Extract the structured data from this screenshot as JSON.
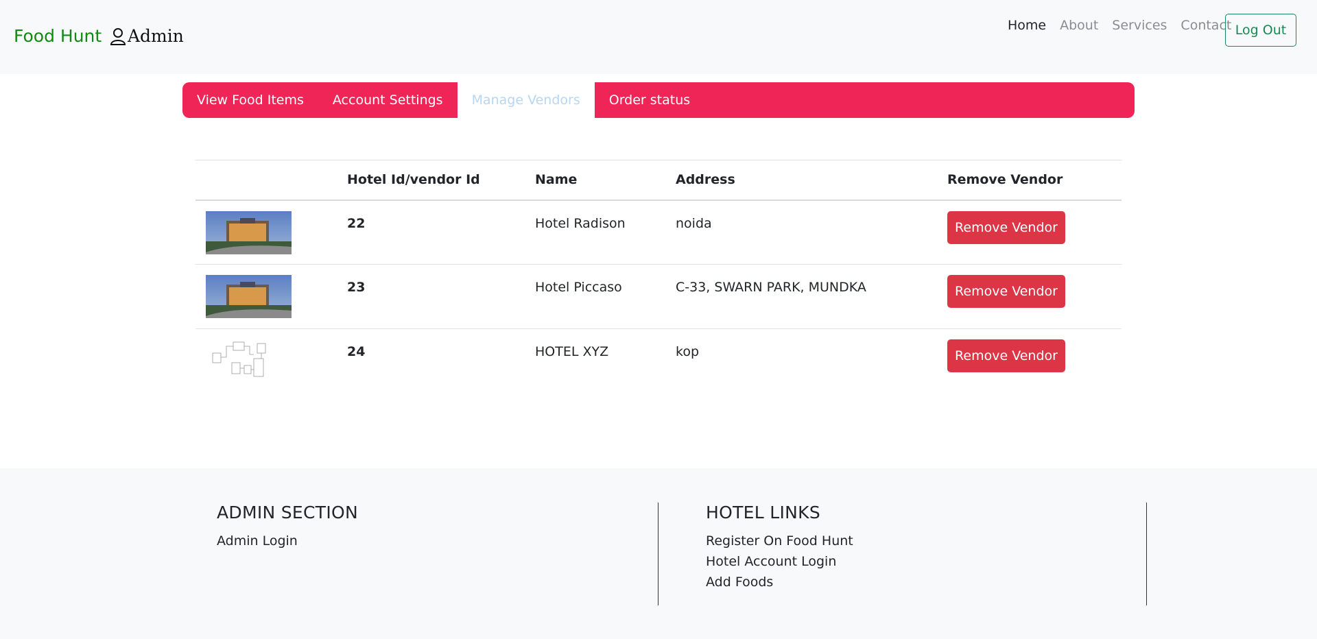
{
  "brand": {
    "name": "Food Hunt",
    "admin_label": "Admin"
  },
  "nav": {
    "links": [
      "Home",
      "About",
      "Services",
      "Contact"
    ],
    "active_index": 0,
    "logout_label": "Log Out"
  },
  "tabs": {
    "items": [
      "View Food Items",
      "Account Settings",
      "Manage Vendors",
      "Order status"
    ],
    "active_index": 2
  },
  "table": {
    "headers": [
      "",
      "Hotel Id/vendor Id",
      "Name",
      "Address",
      "Remove Vendor"
    ],
    "rows": [
      {
        "image": "hotel-building-photo",
        "id": "22",
        "name": "Hotel Radison",
        "address": "noida",
        "action": "Remove Vendor"
      },
      {
        "image": "hotel-building-photo",
        "id": "23",
        "name": "Hotel Piccaso",
        "address": "C-33, SWARN PARK, MUNDKA",
        "action": "Remove Vendor"
      },
      {
        "image": "diagram-thumbnail",
        "id": "24",
        "name": "HOTEL XYZ",
        "address": "kop",
        "action": "Remove Vendor"
      }
    ]
  },
  "footer": {
    "admin": {
      "title": "ADMIN SECTION",
      "links": [
        "Admin Login"
      ]
    },
    "hotel": {
      "title": "HOTEL LINKS",
      "links": [
        "Register On Food Hunt",
        "Hotel Account Login",
        "Add Foods"
      ]
    }
  },
  "colors": {
    "brand": "#128a12",
    "tab_bar": "#ee2556",
    "danger": "#dc3545",
    "success": "#198754"
  }
}
